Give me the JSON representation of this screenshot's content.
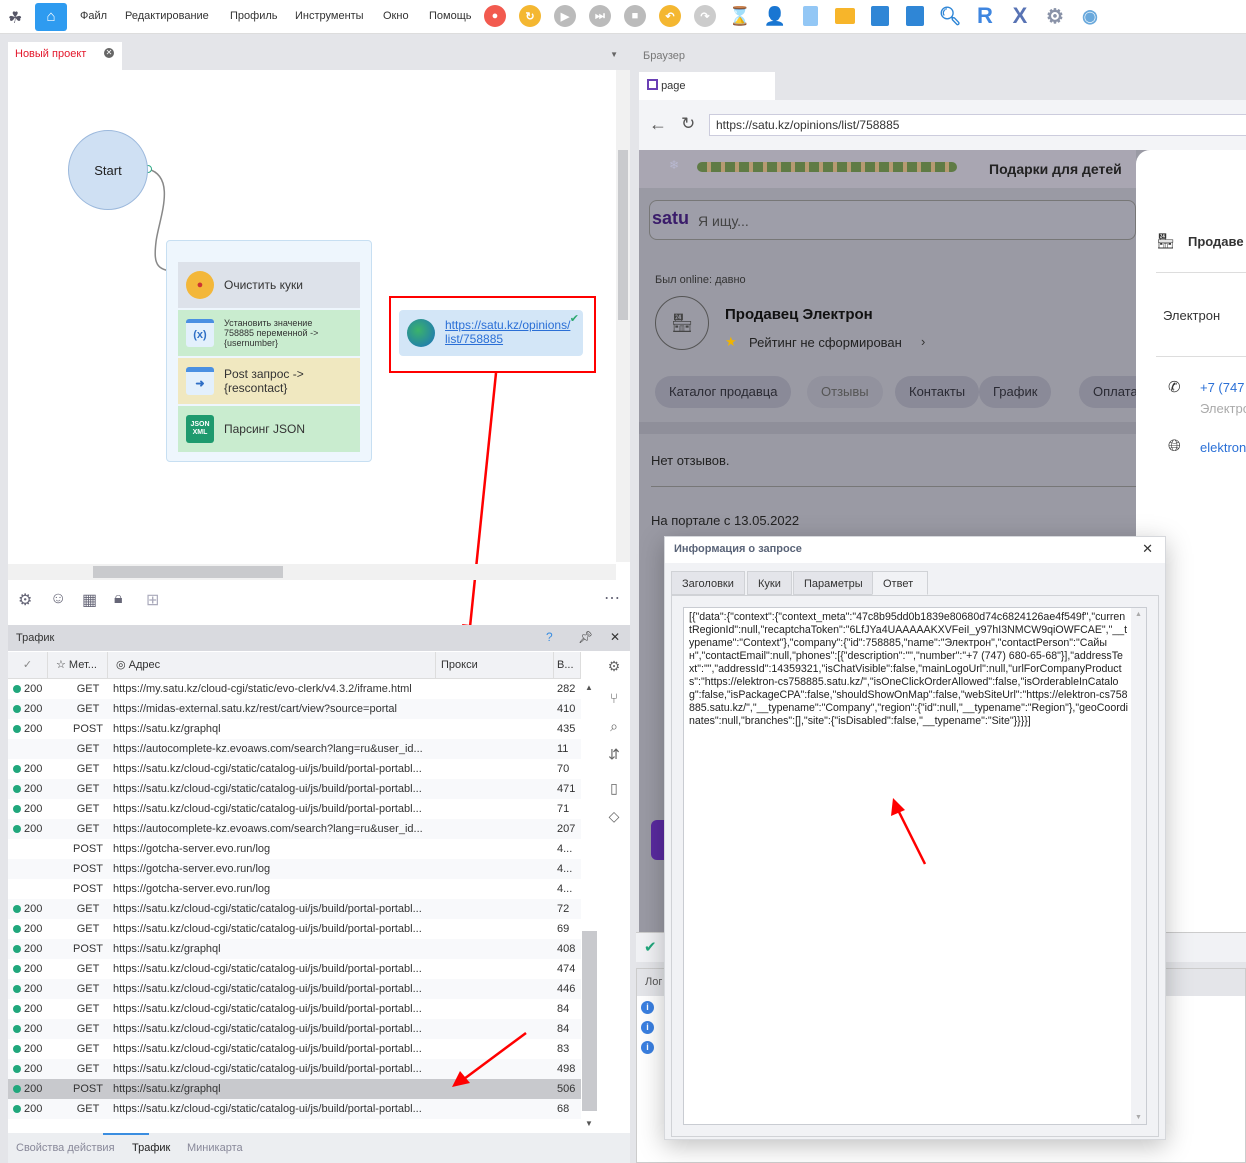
{
  "menubar": {
    "items": [
      "Файл",
      "Редактирование",
      "Профиль",
      "Инструменты",
      "Окно",
      "Помощь"
    ],
    "icons": [
      "logo-icon",
      "home-icon",
      "record-icon",
      "refresh-icon",
      "play-icon",
      "step-icon",
      "stop-icon",
      "undo-icon",
      "redo-icon",
      "hourglass-icon",
      "user-icon",
      "new-file-icon",
      "open-folder-icon",
      "save-icon",
      "save-as-icon",
      "search-icon",
      "r-icon",
      "x-icon",
      "settings-icon",
      "eye-icon"
    ],
    "r_label": "R",
    "x_label": "X"
  },
  "project": {
    "tab_label": "Новый проект",
    "start_label": "Start",
    "nodes": [
      {
        "label": "Очистить куки",
        "icon": "cookie-icon",
        "color": "#dde2ea"
      },
      {
        "label": "Установить значение 758885 переменной -> {usernumber}",
        "icon": "variable-icon",
        "icon_text": "(x)",
        "color": "#c9eccf"
      },
      {
        "label": "Post запрос -> {rescontact}",
        "icon": "post-request-icon",
        "color": "#f0e8c0"
      },
      {
        "label": "Парсинг JSON",
        "icon": "json-icon",
        "icon_text": "JSON XML",
        "color": "#c9eccf"
      }
    ],
    "nav_node": {
      "url": "https://satu.kz/opinions/list/758885",
      "icon": "globe-icon"
    }
  },
  "traffic": {
    "title": "Трафик",
    "help": "?",
    "columns": [
      "Мет...",
      "Адрес",
      "Прокси",
      "В..."
    ],
    "rows": [
      {
        "status": "200",
        "method": "GET",
        "url": "https://my.satu.kz/cloud-cgi/static/evo-clerk/v4.3.2/iframe.html",
        "size": "282"
      },
      {
        "status": "200",
        "method": "GET",
        "url": "https://midas-external.satu.kz/rest/cart/view?source=portal",
        "size": "410"
      },
      {
        "status": "200",
        "method": "POST",
        "url": "https://satu.kz/graphql",
        "size": "435"
      },
      {
        "status": "",
        "method": "GET",
        "url": "https://autocomplete-kz.evoaws.com/search?lang=ru&user_id...",
        "size": "11"
      },
      {
        "status": "200",
        "method": "GET",
        "url": "https://satu.kz/cloud-cgi/static/catalog-ui/js/build/portal-portabl...",
        "size": "70"
      },
      {
        "status": "200",
        "method": "GET",
        "url": "https://satu.kz/cloud-cgi/static/catalog-ui/js/build/portal-portabl...",
        "size": "471"
      },
      {
        "status": "200",
        "method": "GET",
        "url": "https://satu.kz/cloud-cgi/static/catalog-ui/js/build/portal-portabl...",
        "size": "71"
      },
      {
        "status": "200",
        "method": "GET",
        "url": "https://autocomplete-kz.evoaws.com/search?lang=ru&user_id...",
        "size": "207"
      },
      {
        "status": "",
        "method": "POST",
        "url": "https://gotcha-server.evo.run/log",
        "size": "4..."
      },
      {
        "status": "",
        "method": "POST",
        "url": "https://gotcha-server.evo.run/log",
        "size": "4..."
      },
      {
        "status": "",
        "method": "POST",
        "url": "https://gotcha-server.evo.run/log",
        "size": "4..."
      },
      {
        "status": "200",
        "method": "GET",
        "url": "https://satu.kz/cloud-cgi/static/catalog-ui/js/build/portal-portabl...",
        "size": "72"
      },
      {
        "status": "200",
        "method": "GET",
        "url": "https://satu.kz/cloud-cgi/static/catalog-ui/js/build/portal-portabl...",
        "size": "69"
      },
      {
        "status": "200",
        "method": "POST",
        "url": "https://satu.kz/graphql",
        "size": "408"
      },
      {
        "status": "200",
        "method": "GET",
        "url": "https://satu.kz/cloud-cgi/static/catalog-ui/js/build/portal-portabl...",
        "size": "474"
      },
      {
        "status": "200",
        "method": "GET",
        "url": "https://satu.kz/cloud-cgi/static/catalog-ui/js/build/portal-portabl...",
        "size": "446"
      },
      {
        "status": "200",
        "method": "GET",
        "url": "https://satu.kz/cloud-cgi/static/catalog-ui/js/build/portal-portabl...",
        "size": "84"
      },
      {
        "status": "200",
        "method": "GET",
        "url": "https://satu.kz/cloud-cgi/static/catalog-ui/js/build/portal-portabl...",
        "size": "84"
      },
      {
        "status": "200",
        "method": "GET",
        "url": "https://satu.kz/cloud-cgi/static/catalog-ui/js/build/portal-portabl...",
        "size": "83"
      },
      {
        "status": "200",
        "method": "GET",
        "url": "https://satu.kz/cloud-cgi/static/catalog-ui/js/build/portal-portabl...",
        "size": "498"
      },
      {
        "status": "200",
        "method": "POST",
        "url": "https://satu.kz/graphql",
        "size": "506",
        "selected": true
      },
      {
        "status": "200",
        "method": "GET",
        "url": "https://satu.kz/cloud-cgi/static/catalog-ui/js/build/portal-portabl...",
        "size": "68"
      }
    ],
    "status_color": "#20a77c"
  },
  "bottom_tabs": [
    {
      "label": "Свойства действия"
    },
    {
      "label": "Трафик",
      "active": true
    },
    {
      "label": "Миникарта"
    }
  ],
  "browser": {
    "title": "Браузер",
    "tab_label": "page",
    "url": "https://satu.kz/opinions/list/758885",
    "banner": "Подарки для детей",
    "search_placeholder": "Я ищу...",
    "logo": "satu",
    "online": "Был online: давно",
    "seller": "Продавец Электрон",
    "rating": "Рейтинг не сформирован",
    "pills": [
      "Каталог продавца",
      "Отзывы",
      "Контакты",
      "График",
      "Оплата"
    ],
    "no_reviews": "Нет отзывов.",
    "since": "На портале с 13.05.2022",
    "side": {
      "heading": "Продаве",
      "name": "Электрон",
      "phone": "+7 (747",
      "phone_sub": "Электро",
      "site": "elektron"
    }
  },
  "dialog": {
    "title": "Информация о запросе",
    "tabs": [
      "Заголовки",
      "Куки",
      "Параметры",
      "Ответ"
    ],
    "active_tab": "Ответ",
    "response": "[{\"data\":{\"context\":{\"context_meta\":\"47c8b95dd0b1839e80680d74c6824126ae4f549f\",\"currentRegionId\":null,\"recaptchaToken\":\"6LfJYa4UAAAAAKXVFeiI_y97hI3NMCW9qiOWFCAE\",\"__typename\":\"Context\"},\"company\":{\"id\":758885,\"name\":\"Электрон\",\"contactPerson\":\"Сайын\",\"contactEmail\":null,\"phones\":[{\"description\":\"\",\"number\":\"+7 (747) 680-65-68\"}],\"addressText\":\"\",\"addressId\":14359321,\"isChatVisible\":false,\"mainLogoUrl\":null,\"urlForCompanyProducts\":\"https://elektron-cs758885.satu.kz/\",\"isOneClickOrderAllowed\":false,\"isOrderableInCatalog\":false,\"isPackageCPA\":false,\"shouldShowOnMap\":false,\"webSiteUrl\":\"https://elektron-cs758885.satu.kz/\",\"__typename\":\"Company\",\"region\":{\"id\":null,\"__typename\":\"Region\"},\"geoCoordinates\":null,\"branches\":[],\"site\":{\"isDisabled\":false,\"__typename\":\"Site\"}}}}]"
  },
  "log": {
    "title": "Лог"
  },
  "annotation_color": "#ff0000"
}
